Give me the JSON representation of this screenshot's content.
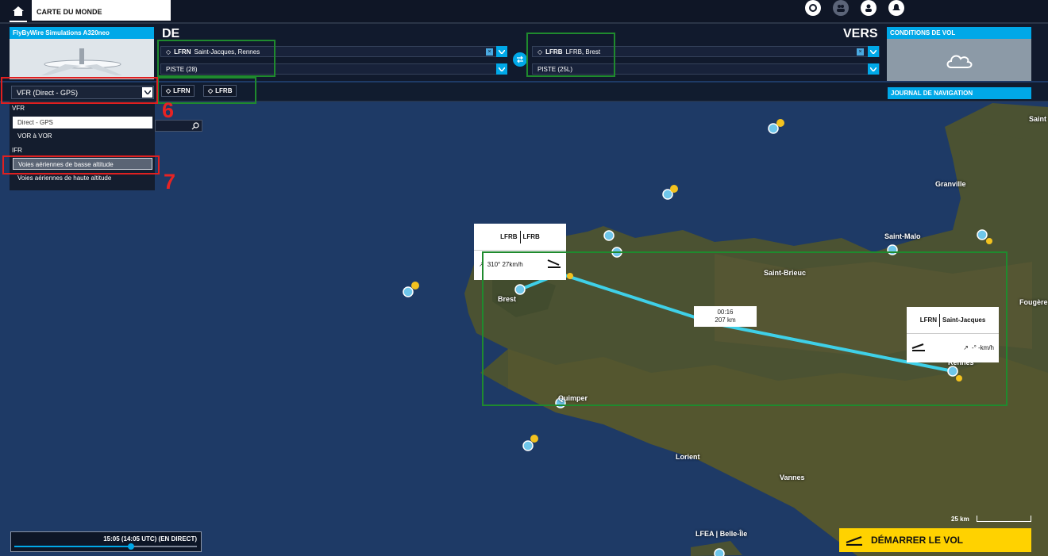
{
  "topbar": {
    "tab_label": "CARTE DU MONDE"
  },
  "aircraft": {
    "name": "FlyByWire Simulations A320neo"
  },
  "departure": {
    "heading": "DE",
    "airport": "LFRN",
    "airport_name": "Saint-Jacques, Rennes",
    "runway": "PISTE (28)"
  },
  "arrival": {
    "heading": "VERS",
    "airport": "LFRB",
    "airport_name": "LFRB, Brest",
    "runway": "PISTE (25L)"
  },
  "weather": {
    "title": "CONDITIONS DE VOL",
    "icon": "cloud-icon"
  },
  "route": {
    "chips": [
      "LFRN",
      "LFRB"
    ],
    "navlog_label": "JOURNAL DE NAVIGATION"
  },
  "nav_type": {
    "selected": "VFR (Direct - GPS)",
    "groups": [
      {
        "label": "VFR",
        "items": [
          "Direct - GPS",
          "VOR à VOR"
        ]
      },
      {
        "label": "IFR",
        "items": [
          "Voies aériennes de basse altitude",
          "Voies aériennes de haute altitude"
        ]
      }
    ]
  },
  "annotations": {
    "six": "6",
    "seven": "7"
  },
  "map": {
    "cities": [
      "Saint",
      "Granville",
      "Saint-Malo",
      "Saint-Brieuc",
      "Fougère",
      "Brest",
      "Quimper",
      "Lorient",
      "Vannes",
      "Rennes"
    ],
    "arrival_card": {
      "code": "LFRB",
      "name": "LFRB",
      "wind": "310° 27km/h"
    },
    "departure_card": {
      "code": "LFRN",
      "name": "Saint-Jacques",
      "wind": "-° -km/h"
    },
    "leg": {
      "time": "00:16",
      "distance": "207 km"
    },
    "scale": "25 km",
    "bottom_airport": {
      "code": "LFEA",
      "name": "Belle-Île"
    }
  },
  "time": {
    "label": "15:05 (14:05 UTC) (EN DIRECT)",
    "progress": 0.64
  },
  "start_button": "DÉMARRER LE VOL",
  "colors": {
    "accent": "#00a8e8",
    "route": "#3fd0e8",
    "start": "#ffd200"
  }
}
